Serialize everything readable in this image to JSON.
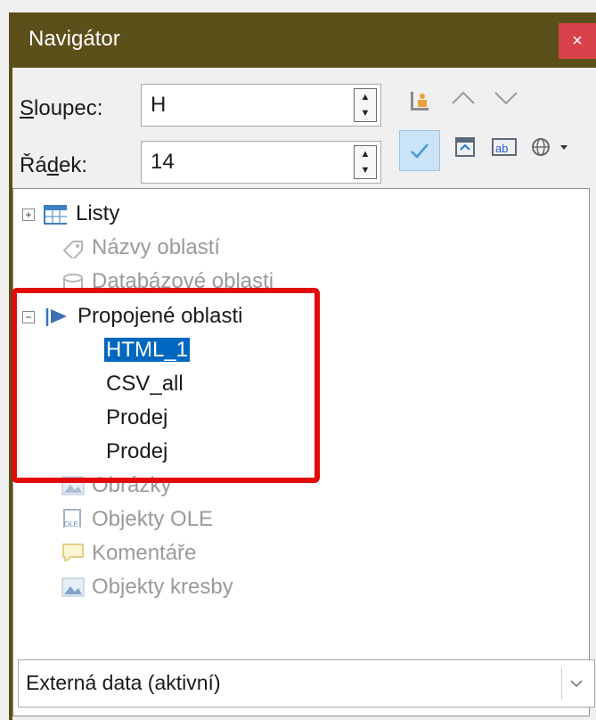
{
  "window": {
    "title": "Navigátor",
    "close_label": "×"
  },
  "column": {
    "label_pre": "",
    "label_key": "S",
    "label_post": "loupec:",
    "value": "H"
  },
  "row": {
    "label_pre": "Řá",
    "label_key": "d",
    "label_post": "ek:",
    "value": "14"
  },
  "toolbar": {
    "icons": [
      "data-range-icon",
      "up-arrow-icon",
      "down-arrow-icon",
      "toggle-icon",
      "scenarios-icon",
      "drag-mode-icon",
      "document-icon"
    ]
  },
  "tree": {
    "sheets": "Listy",
    "range_names": "Názvy oblastí",
    "db_ranges": "Databázové oblasti",
    "linked_areas": "Propojené oblasti",
    "linked_items": [
      "HTML_1",
      "CSV_all",
      "Prodej",
      "Prodej"
    ],
    "images": "Obrázky",
    "ole_objects": "Objekty OLE",
    "comments": "Komentáře",
    "drawings": "Objekty kresby"
  },
  "document_select": {
    "value": "Externá data (aktivní)"
  }
}
